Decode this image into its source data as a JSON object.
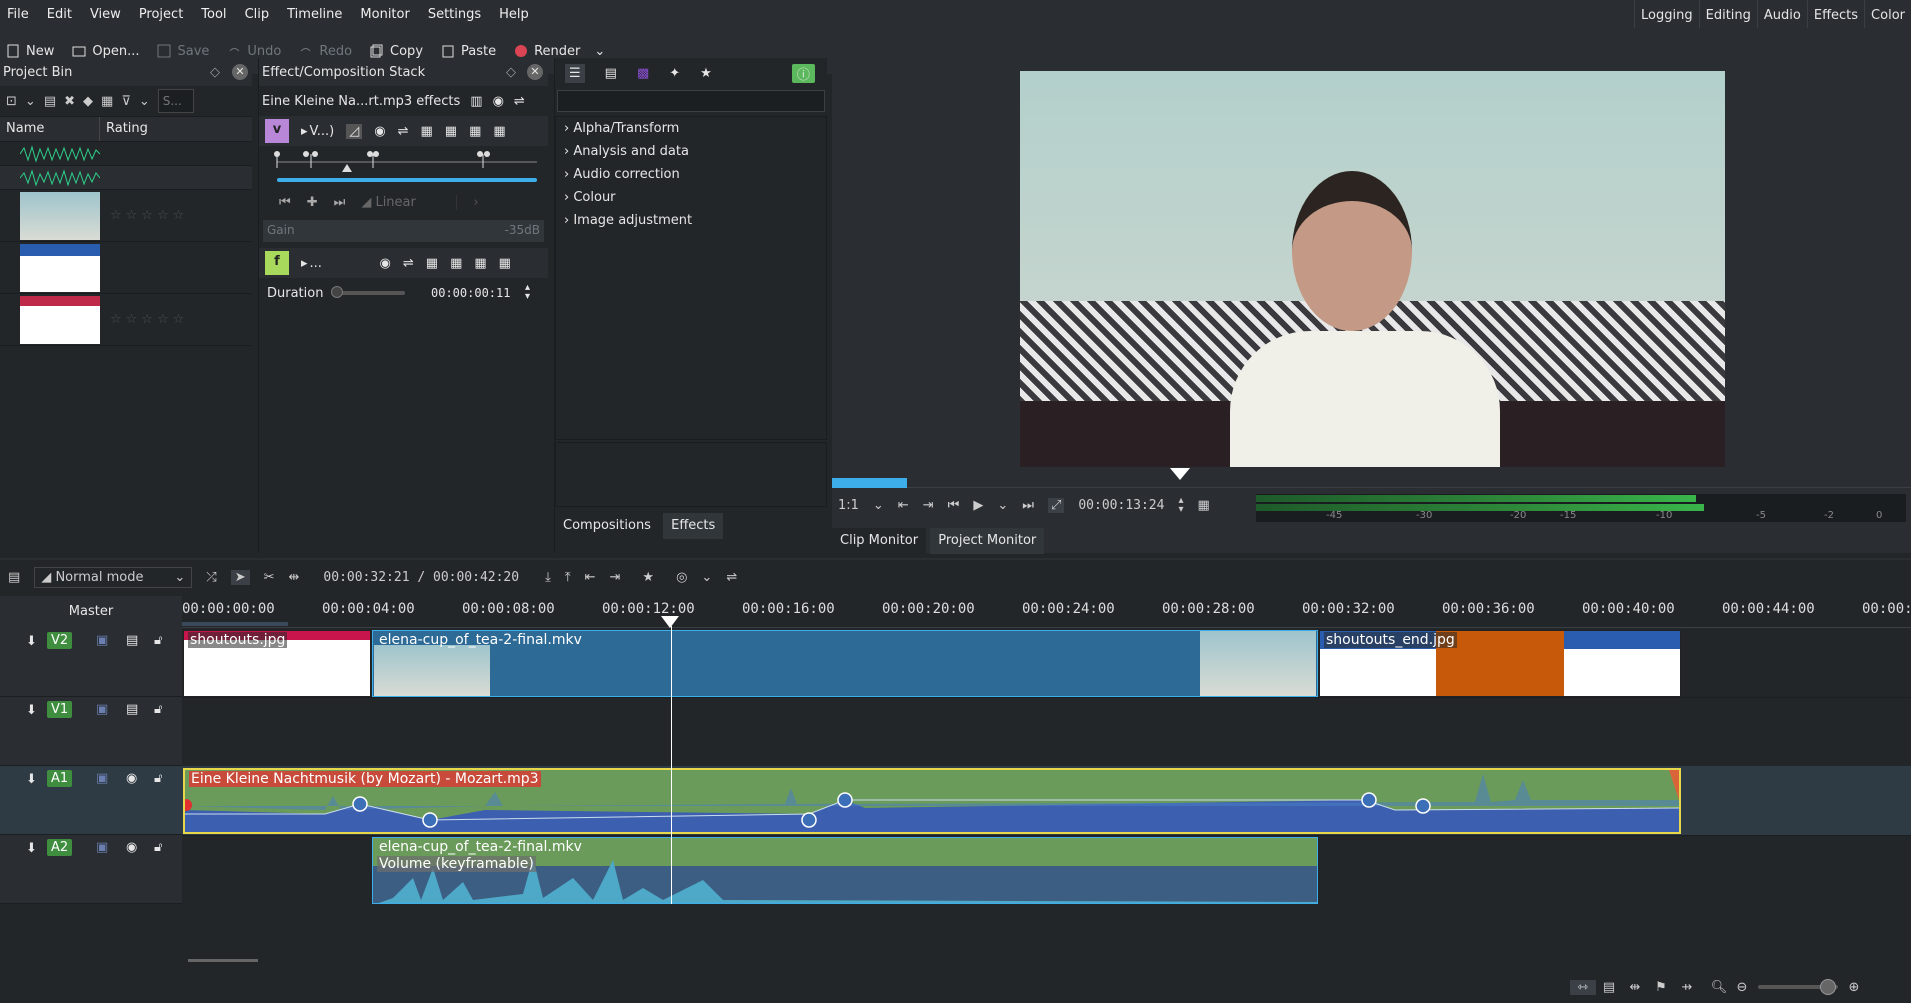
{
  "menu": [
    "File",
    "Edit",
    "View",
    "Project",
    "Tool",
    "Clip",
    "Timeline",
    "Monitor",
    "Settings",
    "Help"
  ],
  "layouts": [
    "Logging",
    "Editing",
    "Audio",
    "Effects",
    "Color"
  ],
  "toolbar": {
    "new": "New",
    "open": "Open...",
    "save": "Save",
    "undo": "Undo",
    "redo": "Redo",
    "copy": "Copy",
    "paste": "Paste",
    "render": "Render"
  },
  "project_bin": {
    "title": "Project Bin",
    "search_placeholder": "S...",
    "col_name": "Name",
    "col_rating": "Rating"
  },
  "effect_stack": {
    "title": "Effect/Composition Stack",
    "clip_title": "Eine Kleine Na...rt.mp3 effects",
    "effect1_badge": "v",
    "effect1_name": "V...)",
    "interp": "Linear",
    "param_label": "Gain",
    "param_value": "-35dB",
    "effect2_badge": "f",
    "effect2_name": "...",
    "duration_label": "Duration",
    "duration_value": "00:00:00:11"
  },
  "effects_list": {
    "categories": [
      "Alpha/Transform",
      "Analysis and data",
      "Audio correction",
      "Colour",
      "Image adjustment"
    ],
    "tab_compositions": "Compositions",
    "tab_effects": "Effects"
  },
  "monitor": {
    "zoom": "1:1",
    "timecode": "00:00:13:24",
    "meter_labels": [
      "-45",
      "-30",
      "-20",
      "-15",
      "-10",
      "-5",
      "-2",
      "0"
    ],
    "tab_clip": "Clip Monitor",
    "tab_project": "Project Monitor"
  },
  "timeline": {
    "mode": "Normal mode",
    "position": "00:00:32:21 / 00:00:42:20",
    "master": "Master",
    "ruler": [
      "00:00:00:00",
      "00:00:04:00",
      "00:00:08:00",
      "00:00:12:00",
      "00:00:16:00",
      "00:00:20:00",
      "00:00:24:00",
      "00:00:28:00",
      "00:00:32:00",
      "00:00:36:00",
      "00:00:40:00",
      "00:00:44:00",
      "00:00:"
    ],
    "tracks": [
      "V2",
      "V1",
      "A1",
      "A2"
    ],
    "clips": {
      "v2_a": "shoutouts.jpg",
      "v2_b": "elena-cup_of_tea-2-final.mkv",
      "v2_c": "shoutouts_end.jpg",
      "a1": "Eine Kleine Nachtmusik (by Mozart) - Mozart.mp3",
      "a2": "elena-cup_of_tea-2-final.mkv",
      "a2_sub": "Volume (keyframable)"
    }
  },
  "colors": {
    "accent": "#3daee9",
    "audio_clip": "#6a9b5a",
    "video_clip": "#2d6a96",
    "track_badge": "#3f8e3f",
    "render_dot": "#da4453"
  }
}
